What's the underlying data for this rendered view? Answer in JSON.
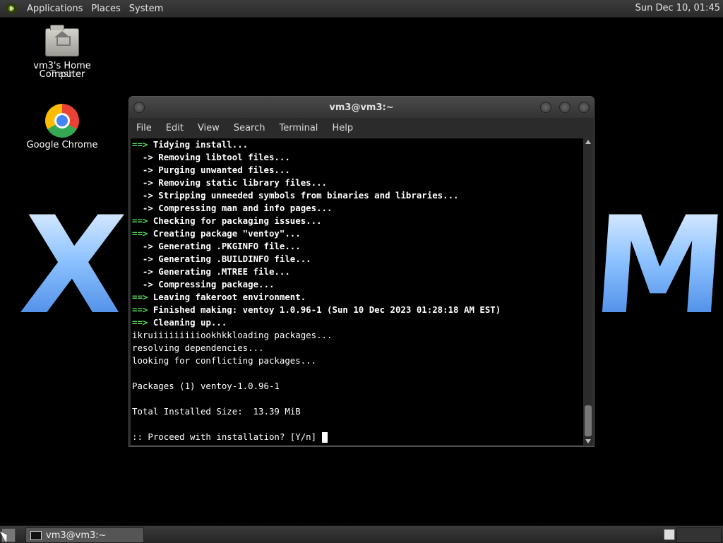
{
  "top_panel": {
    "menus": [
      "Applications",
      "Places",
      "System"
    ],
    "clock": "Sun Dec 10, 01:45"
  },
  "wallpaper": {
    "left_text": "XI",
    "right_text": "M"
  },
  "desktop": {
    "icons": [
      {
        "label_a": "vm3's Home",
        "label_b": "Computer",
        "label_c": "Trash",
        "icon": "home-folder-icon"
      },
      {
        "label": "Google Chrome",
        "icon": "chrome-icon"
      }
    ]
  },
  "terminal": {
    "title": "vm3@vm3:~",
    "menu": [
      "File",
      "Edit",
      "View",
      "Search",
      "Terminal",
      "Help"
    ],
    "lines": [
      {
        "prefix": "==>",
        "text": " Tidying install...",
        "bold": true
      },
      {
        "prefix": "  ->",
        "text": " Removing libtool files...",
        "bold": true
      },
      {
        "prefix": "  ->",
        "text": " Purging unwanted files...",
        "bold": true
      },
      {
        "prefix": "  ->",
        "text": " Removing static library files...",
        "bold": true
      },
      {
        "prefix": "  ->",
        "text": " Stripping unneeded symbols from binaries and libraries...",
        "bold": true
      },
      {
        "prefix": "  ->",
        "text": " Compressing man and info pages...",
        "bold": true
      },
      {
        "prefix": "==>",
        "text": " Checking for packaging issues...",
        "bold": true
      },
      {
        "prefix": "==>",
        "text": " Creating package \"ventoy\"...",
        "bold": true
      },
      {
        "prefix": "  ->",
        "text": " Generating .PKGINFO file...",
        "bold": true
      },
      {
        "prefix": "  ->",
        "text": " Generating .BUILDINFO file...",
        "bold": true
      },
      {
        "prefix": "  ->",
        "text": " Generating .MTREE file...",
        "bold": true
      },
      {
        "prefix": "  ->",
        "text": " Compressing package...",
        "bold": true
      },
      {
        "prefix": "==>",
        "text": " Leaving fakeroot environment.",
        "bold": true
      },
      {
        "prefix": "==>",
        "text": " Finished making: ventoy 1.0.96-1 (Sun 10 Dec 2023 01:28:18 AM EST)",
        "bold": true
      },
      {
        "prefix": "==>",
        "text": " Cleaning up...",
        "bold": true
      },
      {
        "prefix": "",
        "text": "ikruiiiiiiiiiookhkkloading packages...",
        "bold": false
      },
      {
        "prefix": "",
        "text": "resolving dependencies...",
        "bold": false
      },
      {
        "prefix": "",
        "text": "looking for conflicting packages...",
        "bold": false
      },
      {
        "prefix": "",
        "text": "",
        "bold": false
      },
      {
        "prefix": "",
        "text": "Packages (1) ventoy-1.0.96-1",
        "bold": false
      },
      {
        "prefix": "",
        "text": "",
        "bold": false
      },
      {
        "prefix": "",
        "text": "Total Installed Size:  13.39 MiB",
        "bold": false
      },
      {
        "prefix": "",
        "text": "",
        "bold": false
      },
      {
        "prefix": "",
        "text": ":: Proceed with installation? [Y/n] ",
        "bold": false,
        "cursor": true
      }
    ]
  },
  "taskbar": {
    "task_label": "vm3@vm3:~"
  }
}
